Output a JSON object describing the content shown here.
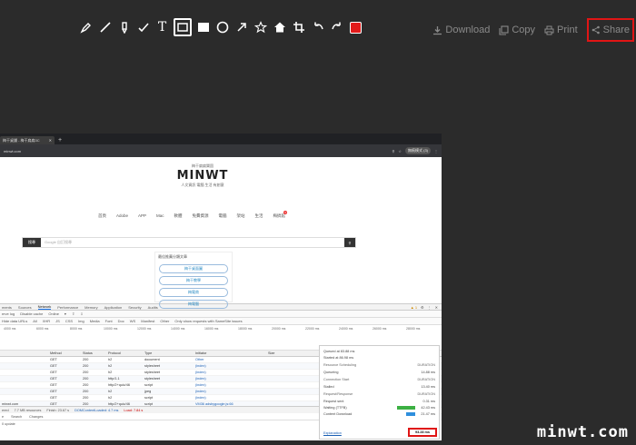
{
  "toolbar": {
    "tools": [
      "pen-icon",
      "line-icon",
      "marker-icon",
      "check-icon",
      "text-icon",
      "rect-outline-icon",
      "rect-fill-icon",
      "circle-icon",
      "arrow-icon",
      "star-icon",
      "home-icon",
      "crop-icon",
      "undo-icon",
      "redo-icon"
    ],
    "text_tool_label": "T",
    "active_tool": "rect-outline-icon",
    "color": "#e21b1b"
  },
  "actions": {
    "download": "Download",
    "copy": "Copy",
    "print": "Print",
    "share": "Share"
  },
  "browser": {
    "tab_title": "梅干桌舖 - 梅干扁扁3C",
    "url": "minwt.com",
    "incognito": "無痕模式 (3)"
  },
  "site": {
    "logo_top": "梅干扁扁樂園",
    "logo": "MINWT",
    "logo_sub": "人文資訊 電腦 生活 有創意",
    "nav": [
      "首頁",
      "Adobe",
      "APP",
      "Mac",
      "軟體",
      "免費資源",
      "電腦",
      "架站",
      "生活",
      "梅搞館"
    ],
    "nav_badge": "4",
    "search_button": "搜尋",
    "search_placeholder": "Google 自訂搜尋",
    "suggest_title": "最佳推薦分類文章",
    "pills": [
      "梅干桌面圖",
      "梅干教學",
      "梅電商",
      "梅電腦",
      "梅電腦"
    ]
  },
  "devtools": {
    "tabs": [
      "ments",
      "Sources",
      "Network",
      "Performance",
      "Memory",
      "Application",
      "Security",
      "Audits"
    ],
    "active_tab": "Network",
    "warn": "▲ 1",
    "filter": [
      "erve log",
      "Disable cache",
      "Online",
      "▾",
      "⇧",
      "⇩"
    ],
    "filter2": [
      "Hide data URLs",
      "All",
      "XHR",
      "JS",
      "CSS",
      "Img",
      "Media",
      "Font",
      "Doc",
      "WS",
      "Manifest",
      "Other",
      "Only show requests with SameSite issues"
    ],
    "ticks": [
      "4000 ms",
      "6000 ms",
      "8000 ms",
      "10000 ms",
      "12000 ms",
      "14000 ms",
      "16000 ms",
      "18000 ms",
      "20000 ms",
      "22000 ms",
      "24000 ms",
      "26000 ms",
      "28000 ms"
    ],
    "columns": [
      "",
      "Method",
      "Status",
      "Protocol",
      "Type",
      "Initiator",
      "Size",
      "Time",
      "Waterfall"
    ],
    "rows": [
      [
        "",
        "GET",
        "200",
        "h2",
        "document",
        "Other",
        "",
        "",
        ""
      ],
      [
        "",
        "GET",
        "200",
        "h2",
        "stylesheet",
        "(index)",
        "",
        "",
        ""
      ],
      [
        "",
        "GET",
        "200",
        "h2",
        "stylesheet",
        "(index)",
        "",
        "",
        ""
      ],
      [
        "",
        "GET",
        "200",
        "http/1.1",
        "stylesheet",
        "(index)",
        "",
        "",
        ""
      ],
      [
        "",
        "GET",
        "200",
        "http/2+quic/46",
        "script",
        "(index)",
        "",
        "",
        ""
      ],
      [
        "",
        "GET",
        "200",
        "h2",
        "jpeg",
        "(index)",
        "",
        "",
        ""
      ],
      [
        "",
        "GET",
        "200",
        "h2",
        "script",
        "(index)",
        "",
        "",
        ""
      ],
      [
        "minwt.com",
        "GET",
        "200",
        "http/2+quic/46",
        "script",
        "VM36 adsbygoogle.js:66",
        "",
        "",
        ""
      ],
      [
        "minwt.com",
        "GET",
        "200",
        "http/2+quic/46",
        "script",
        "VM36 adsbygoogle.js:66",
        "",
        "",
        ""
      ],
      [
        "",
        "GET",
        "200",
        "http/2+quic/46",
        "script",
        "(index)",
        "",
        "",
        ""
      ]
    ],
    "status": [
      "ered",
      "7.7 MB resources",
      "Finish: 23.67 s",
      "DOMContentLoaded: 4.7 ms",
      "Load: 7.84 s"
    ],
    "console_tabs": [
      "e",
      "Search",
      "Changes"
    ],
    "console_line": "0 update"
  },
  "timing": {
    "queued": "Queued at 83.88 ms",
    "started": "Started at 86.98 ms",
    "sched_head": "Resource Scheduling",
    "duration": "DURATION",
    "queueing": "Queueing",
    "queueing_val": "14.88 ms",
    "conn_head": "Connection Start",
    "stalled": "Stalled",
    "stalled_val": "13.40 ms",
    "req_head": "Request/Response",
    "request_sent": "Request sent",
    "request_sent_val": "0.31 ms",
    "waiting": "Waiting (TTFB)",
    "waiting_val": "42.43 ms",
    "download": "Content Download",
    "download_val": "21.47 ms",
    "explanation": "Explanation",
    "total": "93.28 ms",
    "waiting_color": "#3cb043",
    "download_color": "#2f8fdd"
  },
  "watermark": "minwt.com"
}
